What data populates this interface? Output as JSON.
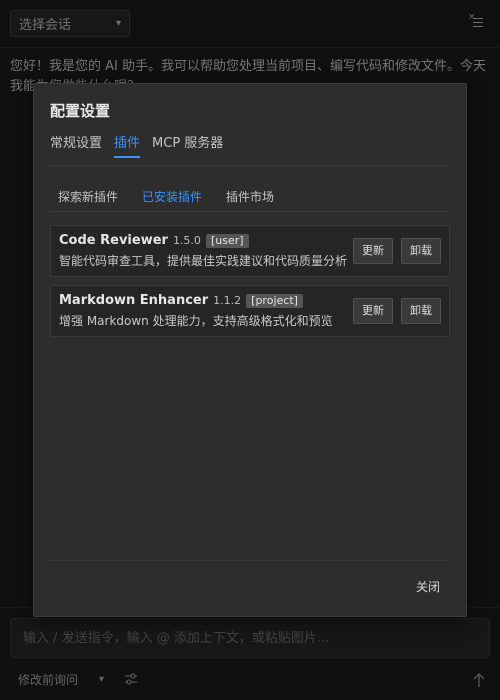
{
  "header": {
    "session_select": "选择会话",
    "menu_icon": "list-close-icon"
  },
  "chat": {
    "assistant_message": "您好！我是您的 AI 助手。我可以帮助您处理当前项目、编写代码和修改文件。今天我能为您做些什么呢？"
  },
  "footer": {
    "input_placeholder": "输入 / 发送指令，输入 @ 添加上下文，或粘贴图片...",
    "mode_select": "修改前询问",
    "settings_icon": "sliders-icon",
    "send_icon": "arrow-up-icon"
  },
  "modal": {
    "title": "配置设置",
    "tabs": [
      {
        "label": "常规设置",
        "active": false
      },
      {
        "label": "插件",
        "active": true
      },
      {
        "label": "MCP 服务器",
        "active": false
      }
    ],
    "sub_tabs": [
      {
        "label": "探索新插件",
        "active": false
      },
      {
        "label": "已安装插件",
        "active": true
      },
      {
        "label": "插件市场",
        "active": false
      }
    ],
    "plugins": [
      {
        "name": "Code Reviewer",
        "version": "1.5.0",
        "scope": "[user]",
        "description": "智能代码审查工具，提供最佳实践建议和代码质量分析",
        "update_label": "更新",
        "uninstall_label": "卸载"
      },
      {
        "name": "Markdown Enhancer",
        "version": "1.1.2",
        "scope": "[project]",
        "description": "增强 Markdown 处理能力，支持高级格式化和预览",
        "update_label": "更新",
        "uninstall_label": "卸载"
      }
    ],
    "close_label": "关闭"
  },
  "colors": {
    "accent": "#3794ff",
    "background": "#1e1e1e",
    "modal_bg": "#2d2d2d"
  }
}
